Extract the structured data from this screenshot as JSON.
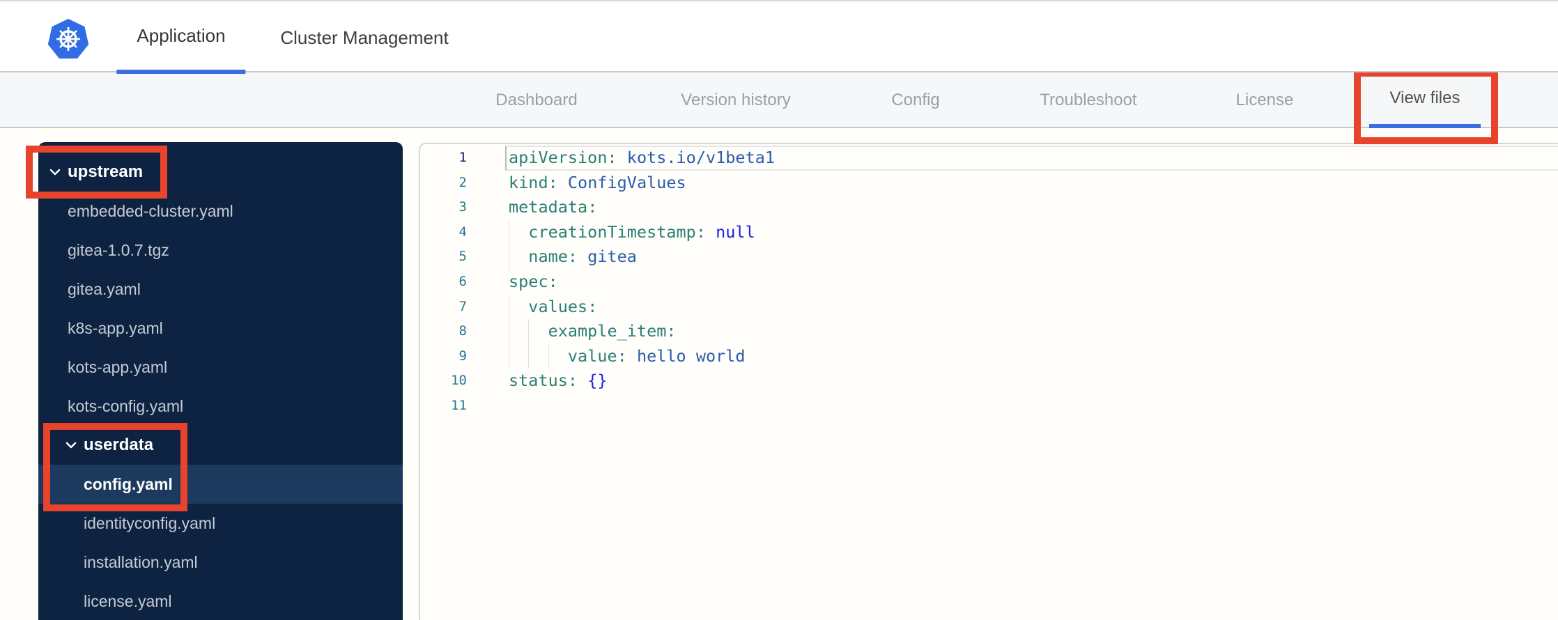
{
  "top_nav": {
    "tabs": [
      {
        "label": "Application",
        "active": true
      },
      {
        "label": "Cluster Management",
        "active": false
      }
    ]
  },
  "sub_nav": {
    "tabs": [
      {
        "label": "Dashboard",
        "active": false
      },
      {
        "label": "Version history",
        "active": false
      },
      {
        "label": "Config",
        "active": false
      },
      {
        "label": "Troubleshoot",
        "active": false
      },
      {
        "label": "License",
        "active": false
      },
      {
        "label": "View files",
        "active": true,
        "annotated": true
      }
    ]
  },
  "sidebar": {
    "tree": [
      {
        "label": "upstream",
        "kind": "folder",
        "level": 0,
        "expanded": true,
        "annotated": true
      },
      {
        "label": "embedded-cluster.yaml",
        "kind": "file",
        "level": 1
      },
      {
        "label": "gitea-1.0.7.tgz",
        "kind": "file",
        "level": 1
      },
      {
        "label": "gitea.yaml",
        "kind": "file",
        "level": 1
      },
      {
        "label": "k8s-app.yaml",
        "kind": "file",
        "level": 1
      },
      {
        "label": "kots-app.yaml",
        "kind": "file",
        "level": 1
      },
      {
        "label": "kots-config.yaml",
        "kind": "file",
        "level": 1
      },
      {
        "label": "userdata",
        "kind": "folder",
        "level": 1,
        "expanded": true,
        "annotated": true
      },
      {
        "label": "config.yaml",
        "kind": "file",
        "level": 2,
        "selected": true,
        "annotated": true
      },
      {
        "label": "identityconfig.yaml",
        "kind": "file",
        "level": 2
      },
      {
        "label": "installation.yaml",
        "kind": "file",
        "level": 2
      },
      {
        "label": "license.yaml",
        "kind": "file",
        "level": 2
      }
    ]
  },
  "editor": {
    "language": "yaml",
    "lines": [
      {
        "num": "1",
        "active": true,
        "guides": 0,
        "tokens": [
          [
            "key",
            "apiVersion"
          ],
          [
            "punc",
            ":"
          ],
          [
            "plain",
            " "
          ],
          [
            "val",
            "kots.io/v1beta1"
          ]
        ]
      },
      {
        "num": "2",
        "guides": 0,
        "tokens": [
          [
            "key",
            "kind"
          ],
          [
            "punc",
            ":"
          ],
          [
            "plain",
            " "
          ],
          [
            "val",
            "ConfigValues"
          ]
        ]
      },
      {
        "num": "3",
        "guides": 0,
        "tokens": [
          [
            "key",
            "metadata"
          ],
          [
            "punc",
            ":"
          ]
        ]
      },
      {
        "num": "4",
        "guides": 1,
        "tokens": [
          [
            "plain",
            "  "
          ],
          [
            "key",
            "creationTimestamp"
          ],
          [
            "punc",
            ":"
          ],
          [
            "plain",
            " "
          ],
          [
            "kw",
            "null"
          ]
        ]
      },
      {
        "num": "5",
        "guides": 1,
        "tokens": [
          [
            "plain",
            "  "
          ],
          [
            "key",
            "name"
          ],
          [
            "punc",
            ":"
          ],
          [
            "plain",
            " "
          ],
          [
            "val",
            "gitea"
          ]
        ]
      },
      {
        "num": "6",
        "guides": 0,
        "tokens": [
          [
            "key",
            "spec"
          ],
          [
            "punc",
            ":"
          ]
        ]
      },
      {
        "num": "7",
        "guides": 1,
        "tokens": [
          [
            "plain",
            "  "
          ],
          [
            "key",
            "values"
          ],
          [
            "punc",
            ":"
          ]
        ]
      },
      {
        "num": "8",
        "guides": 2,
        "tokens": [
          [
            "plain",
            "    "
          ],
          [
            "key",
            "example_item"
          ],
          [
            "punc",
            ":"
          ]
        ]
      },
      {
        "num": "9",
        "guides": 3,
        "tokens": [
          [
            "plain",
            "      "
          ],
          [
            "key",
            "value"
          ],
          [
            "punc",
            ":"
          ],
          [
            "plain",
            " "
          ],
          [
            "val",
            "hello world"
          ]
        ]
      },
      {
        "num": "10",
        "guides": 0,
        "tokens": [
          [
            "key",
            "status"
          ],
          [
            "punc",
            ":"
          ],
          [
            "plain",
            " "
          ],
          [
            "kw",
            "{}"
          ]
        ]
      },
      {
        "num": "11",
        "guides": 0,
        "tokens": []
      }
    ]
  },
  "colors": {
    "brand_blue": "#326ce5",
    "tab_underline": "#3c6ce0",
    "annotation_red": "#e8432d",
    "sidebar_bg": "#0e2342",
    "sidebar_selected": "#1c3a5e",
    "yaml_key": "#2b7f74",
    "yaml_value": "#2a5caa",
    "yaml_keyword": "#1a22dd",
    "line_number": "#237893",
    "line_number_active": "#0b216f"
  }
}
